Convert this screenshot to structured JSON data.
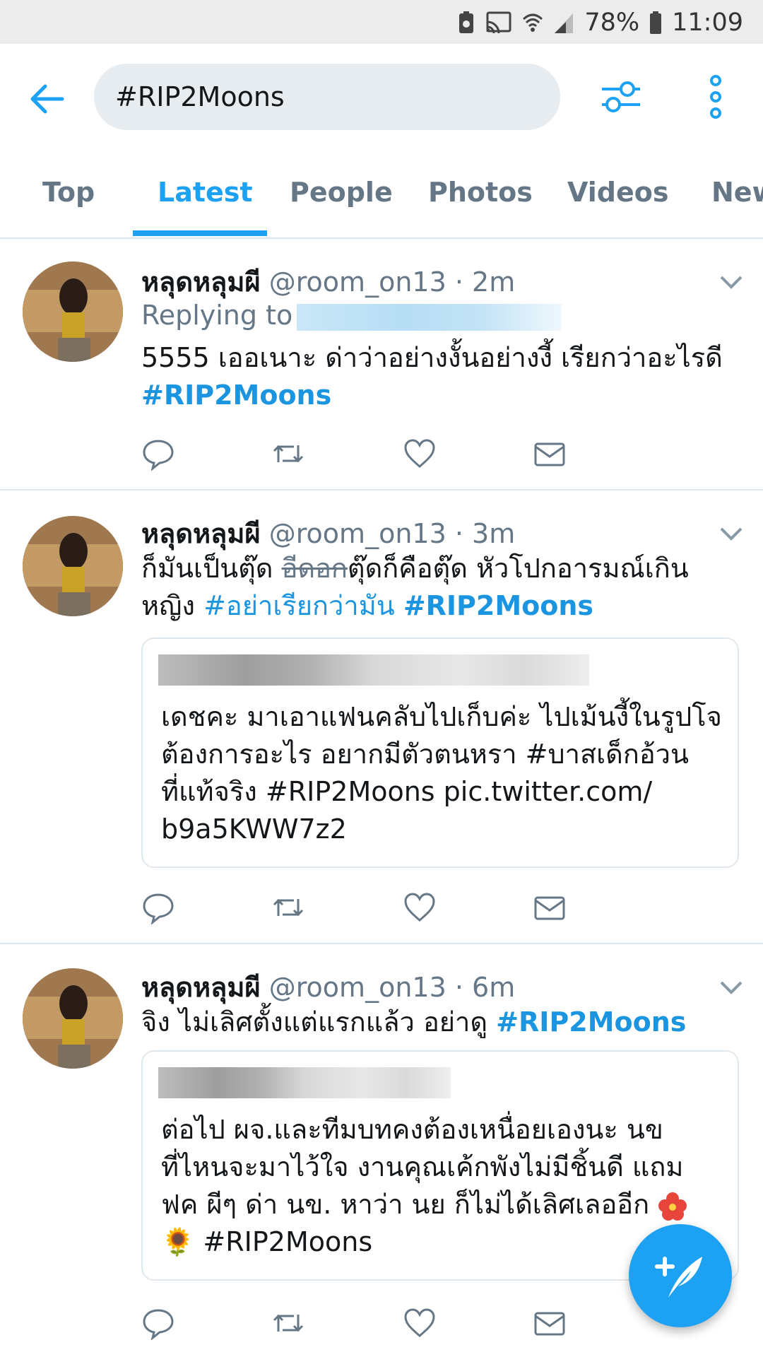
{
  "status_bar": {
    "battery": "78%",
    "time": "11:09"
  },
  "search": {
    "query": "#RIP2Moons"
  },
  "tabs": [
    {
      "label": "Top"
    },
    {
      "label": "Latest"
    },
    {
      "label": "People"
    },
    {
      "label": "Photos"
    },
    {
      "label": "Videos"
    },
    {
      "label": "New"
    }
  ],
  "active_tab": "Latest",
  "tweets": [
    {
      "name": "หลุดหลุมผี",
      "handle": "@room_on13",
      "time": "2m",
      "replying_to": "Replying to",
      "text_1": "5555 เออเนาะ ด่าว่าอย่างงั้นอย่างงี้ เรียกว่าอะไรดี",
      "hashtag_1": "#RIP2Moons"
    },
    {
      "name": "หลุดหลุมผี",
      "handle": "@room_on13",
      "time": "3m",
      "text_1": "ก็มันเป็นตุ๊ด",
      "struck": "อีดอก",
      "text_2": "ตุ๊ดก็คือตุ๊ด หัวโปกอารมณ์เกิน",
      "text_3": "หญิง",
      "hashtag_1": "#อย่าเรียกว่ามัน",
      "hashtag_2": "#RIP2Moons",
      "quote": {
        "line_1": "เดชคะ มาเอาแฟนคลับไปเก็บค่ะ ไปเม้นงี้ในรูปโจ",
        "line_2": "ต้องการอะไร อยากมีตัวตนหรา #บาสเด็กอ้วน",
        "line_3": "ที่แท้จริง #RIP2Moons pic.twitter.com/",
        "line_4": "b9a5KWW7z2"
      }
    },
    {
      "name": "หลุดหลุมผี",
      "handle": "@room_on13",
      "time": "6m",
      "text_1": "จิง ไม่เลิศตั้งแต่แรกแล้ว อย่าดู",
      "hashtag_1": "#RIP2Moons",
      "quote": {
        "line_1": "ต่อไป ผจ.และทีมบทคงต้องเหนื่อยเองนะ นข",
        "line_2": "ที่ไหนจะมาไว้ใจ งานคุณเค้กพังไม่มีชิ้นดี แถม",
        "line_3": "ฟค ผีๆ ด่า นข. หาว่า นย ก็ไม่ได้เลิศเลออีก",
        "line_4_emoji": "🌻",
        "line_4": "#RIP2Moons"
      }
    }
  ],
  "colors": {
    "accent": "#1da1f2",
    "hashtag": "#1b95e0",
    "secondary_text": "#657786",
    "divider": "#e1e8ed"
  },
  "icons": {
    "back": "back-arrow-icon",
    "filter": "filter-icon",
    "more": "more-vertical-icon",
    "reply": "reply-icon",
    "retweet": "retweet-icon",
    "like": "heart-icon",
    "dm": "envelope-icon",
    "compose": "compose-tweet-icon"
  }
}
